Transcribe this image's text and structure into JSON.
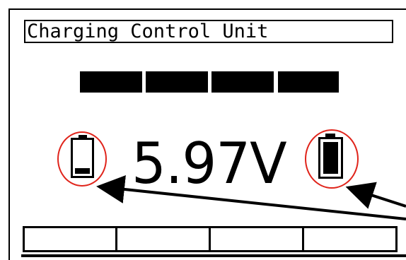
{
  "screen": {
    "title": "Charging Control Unit",
    "voltage": "5.97V",
    "progress_segments": 4
  },
  "batteries": [
    {
      "name": "battery-low-icon",
      "level": 0.2
    },
    {
      "name": "battery-full-icon",
      "level": 1.0
    }
  ],
  "softkeys": [
    "",
    "",
    "",
    ""
  ],
  "colors": {
    "annotation": "#e0241b",
    "foreground": "#000000",
    "background": "#ffffff"
  }
}
